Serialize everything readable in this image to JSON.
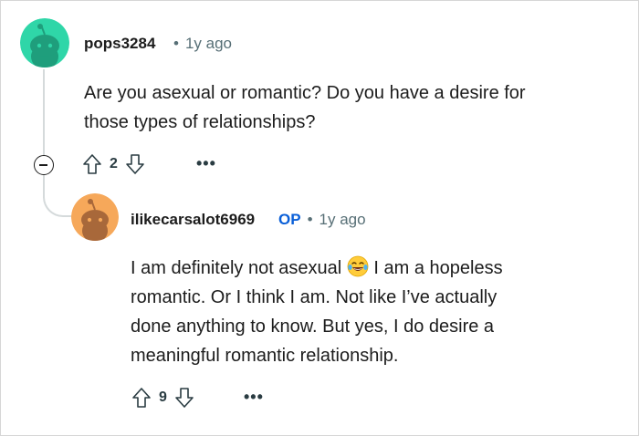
{
  "comment1": {
    "username": "pops3284",
    "time": "1y ago",
    "separator": "•",
    "body_lines": [
      "Are you asexual or romantic? Do you have a desire for",
      "those types of relationships?"
    ],
    "score": "2",
    "more": "•••",
    "avatar_color": "#2fd6a8"
  },
  "comment2": {
    "username": "ilikecarsalot6969",
    "op_badge": "OP",
    "time": "1y ago",
    "separator": "•",
    "body_line1_part1": "I am definitely not asexual",
    "body_line1_part2": "I am a hopeless",
    "body_lines": [
      "romantic. Or I think I am. Not like I’ve actually",
      "done anything to know. But yes, I do desire a",
      "meaningful romantic relationship."
    ],
    "emoji": "laughing-tears",
    "score": "9",
    "more": "•••",
    "avatar_color": "#f6a85a"
  },
  "colors": {
    "thread_line": "#d5dadb",
    "op_blue": "#0a5fd8",
    "meta_gray": "#576f76"
  }
}
